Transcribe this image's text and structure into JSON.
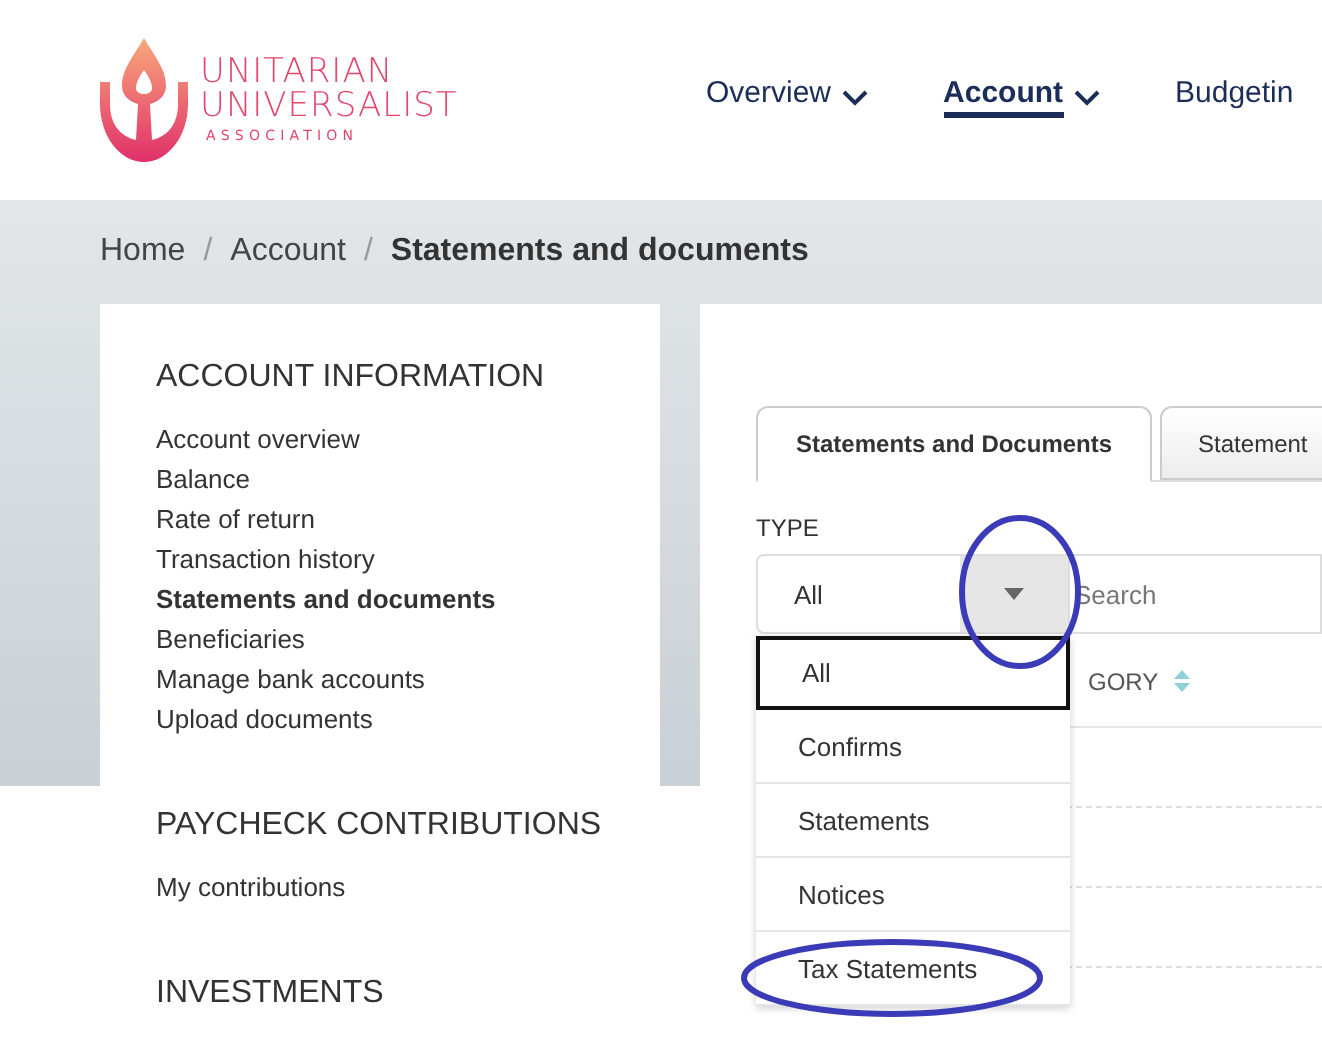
{
  "header": {
    "logo": {
      "line_1": "UNITARIAN",
      "line_2": "UNIVERSALIST",
      "line_3": "ASSOCIATION"
    },
    "nav": [
      {
        "label": "Overview",
        "selected": false,
        "has_caret": true
      },
      {
        "label": "Account",
        "selected": true,
        "has_caret": true
      },
      {
        "label": "Budgetin",
        "selected": false,
        "has_caret": false
      }
    ]
  },
  "breadcrumb": [
    {
      "label": "Home",
      "current": false
    },
    {
      "separator": "/",
      "label": "Account",
      "current": false
    },
    {
      "separator": "/",
      "label": "Statements and documents",
      "current": true
    }
  ],
  "sidebar": {
    "sections": [
      {
        "title": "ACCOUNT INFORMATION",
        "items": [
          {
            "label": "Account overview",
            "selected": false
          },
          {
            "label": "Balance",
            "selected": false
          },
          {
            "label": "Rate of return",
            "selected": false
          },
          {
            "label": "Transaction history",
            "selected": false
          },
          {
            "label": "Statements and documents",
            "selected": true
          },
          {
            "label": "Beneficiaries",
            "selected": false
          },
          {
            "label": "Manage bank accounts",
            "selected": false
          },
          {
            "label": "Upload documents",
            "selected": false
          }
        ]
      },
      {
        "title": "PAYCHECK CONTRIBUTIONS",
        "items": [
          {
            "label": "My contributions",
            "selected": false
          }
        ]
      },
      {
        "title": "INVESTMENTS"
      }
    ]
  },
  "main": {
    "tabs": [
      {
        "label": "Statements and Documents",
        "selected": true
      },
      {
        "label": "Statement",
        "selected": false
      }
    ],
    "type_filter": {
      "label": "TYPE",
      "value": "All",
      "expanded": true,
      "options": [
        {
          "label": "All",
          "selected": true
        },
        {
          "label": "Confirms",
          "selected": false
        },
        {
          "label": "Statements",
          "selected": false
        },
        {
          "label": "Notices",
          "selected": false
        },
        {
          "label": "Tax Statements",
          "selected": false
        }
      ]
    },
    "search": {
      "placeholder": "Search"
    },
    "table": {
      "columns": [
        {
          "label": "GORY",
          "sortable": true
        }
      ]
    }
  }
}
